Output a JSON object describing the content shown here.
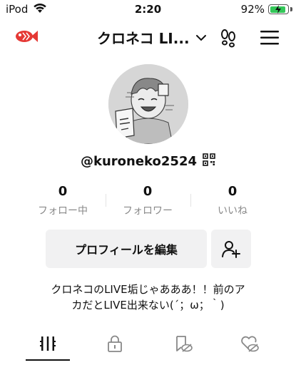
{
  "status_bar": {
    "carrier": "iPod",
    "time": "2:20",
    "battery_percent": "92%",
    "battery_level": 0.92
  },
  "header": {
    "account_name": "クロネコ LI...",
    "icons": {
      "left": "fish-icon",
      "dropdown": "chevron-down-icon",
      "visitors": "footprint-icon",
      "menu": "hamburger-menu-icon"
    }
  },
  "profile": {
    "username": "@kuroneko2524",
    "stats": [
      {
        "value": "0",
        "label": "フォロー中"
      },
      {
        "value": "0",
        "label": "フォロワー"
      },
      {
        "value": "0",
        "label": "いいね"
      }
    ],
    "edit_button_label": "プロフィールを編集",
    "bio_line1": "クロネコのLIVE垢じゃあああ！！前のア",
    "bio_line2": "カだとLIVE出来ない(´；ω；｀)"
  },
  "tabs": [
    {
      "name": "videos",
      "icon": "grid-icon",
      "active": true
    },
    {
      "name": "private",
      "icon": "lock-icon",
      "active": false
    },
    {
      "name": "reposts",
      "icon": "hidden-bookmark-icon",
      "active": false
    },
    {
      "name": "liked",
      "icon": "hidden-heart-icon",
      "active": false
    }
  ],
  "colors": {
    "accent_fish": "#e53935",
    "battery_green": "#34c759",
    "button_bg": "#f1f1f2",
    "muted_text": "#8a8a8a"
  }
}
